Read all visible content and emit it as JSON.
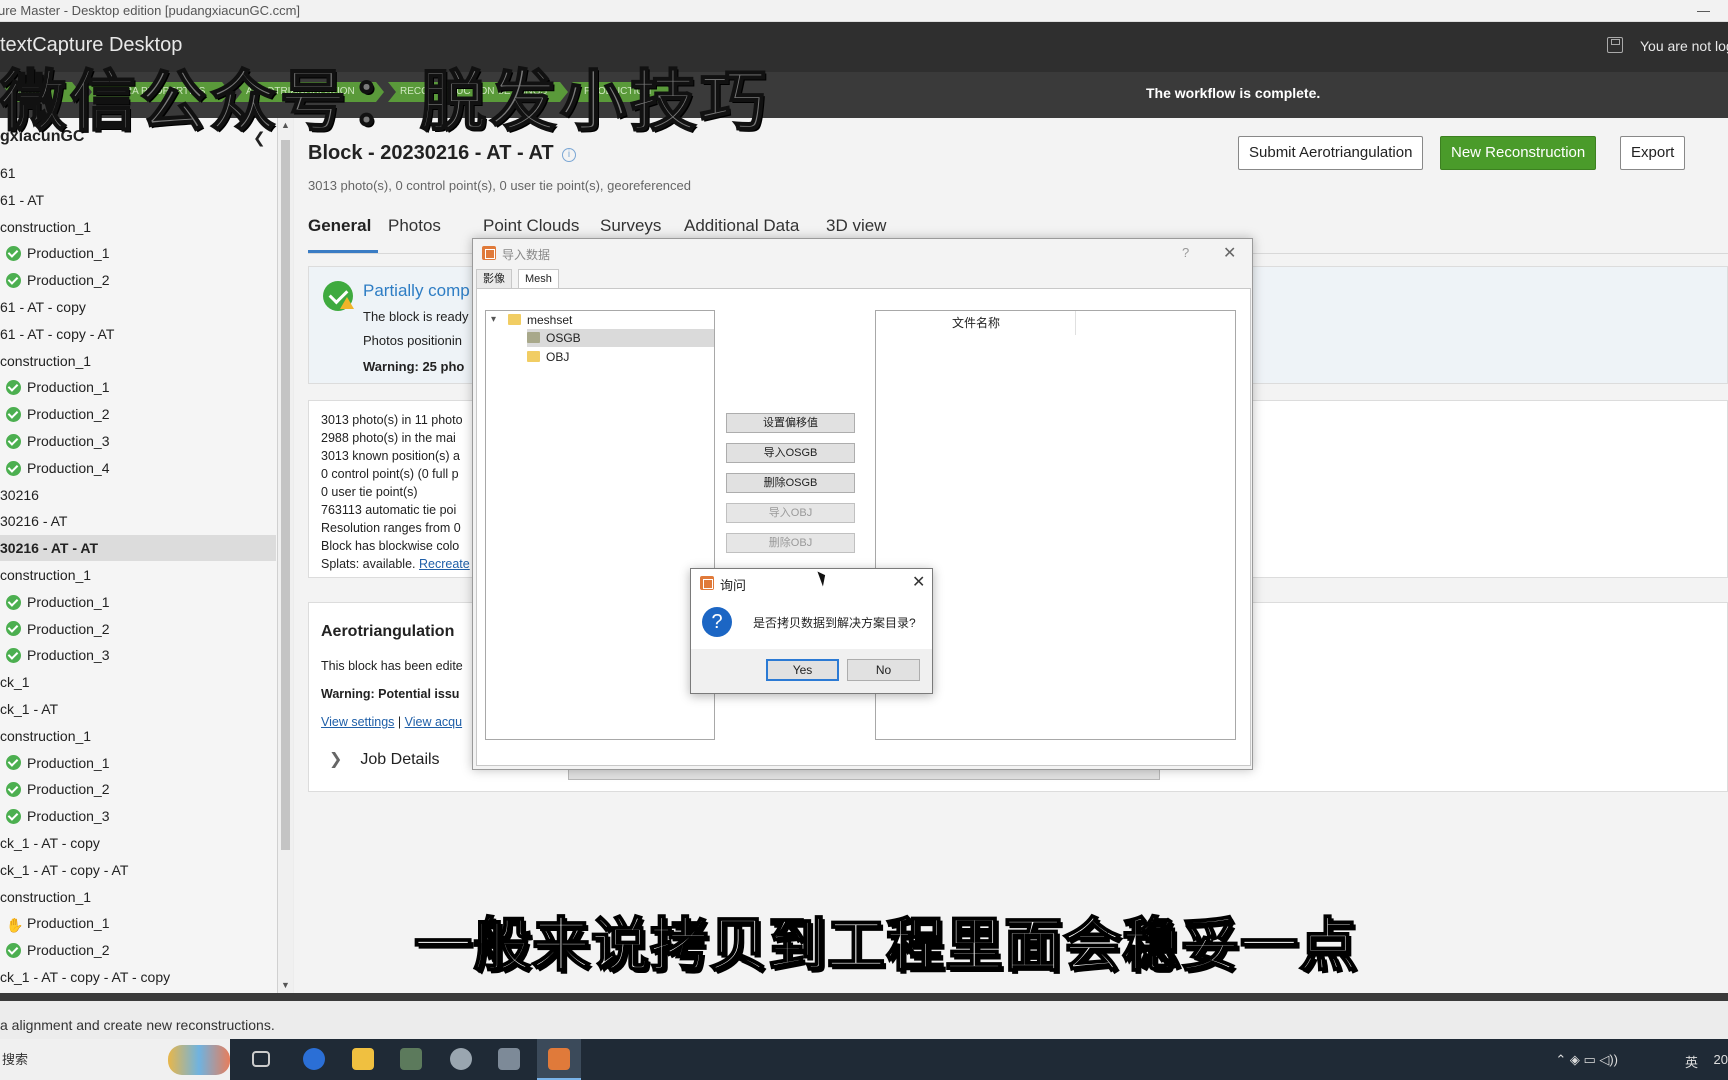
{
  "window": {
    "title": "ure Master - Desktop edition [pudangxiacunGC.ccm]",
    "minimize": "—"
  },
  "appbar": {
    "app_name": "textCapture Desktop",
    "user_status": "You are not log"
  },
  "watermark": "微信公众号：脱发小技巧",
  "workflow": {
    "steps": [
      "OUDS",
      "CAMERA PROPERTIES",
      "AEROTRIANGULATION",
      "RECONSTRUCTION SETTINGS",
      "PRODUCTION"
    ],
    "status": "The workflow is complete."
  },
  "sidebar": {
    "project": "gxiacunGC",
    "items": [
      {
        "label": "61",
        "indent": 0,
        "icon": ""
      },
      {
        "label": "61 - AT",
        "indent": 0,
        "icon": ""
      },
      {
        "label": "construction_1",
        "indent": 0,
        "icon": ""
      },
      {
        "label": "Production_1",
        "indent": 1,
        "icon": "ok"
      },
      {
        "label": "Production_2",
        "indent": 1,
        "icon": "ok"
      },
      {
        "label": "61 - AT - copy",
        "indent": 0,
        "icon": ""
      },
      {
        "label": "61 - AT - copy - AT",
        "indent": 0,
        "icon": ""
      },
      {
        "label": "construction_1",
        "indent": 0,
        "icon": ""
      },
      {
        "label": "Production_1",
        "indent": 1,
        "icon": "ok"
      },
      {
        "label": "Production_2",
        "indent": 1,
        "icon": "ok"
      },
      {
        "label": "Production_3",
        "indent": 1,
        "icon": "ok"
      },
      {
        "label": "Production_4",
        "indent": 1,
        "icon": "ok"
      },
      {
        "label": "30216",
        "indent": 0,
        "icon": ""
      },
      {
        "label": "30216 - AT",
        "indent": 0,
        "icon": ""
      },
      {
        "label": "30216 - AT - AT",
        "indent": 0,
        "icon": "",
        "selected": true
      },
      {
        "label": "construction_1",
        "indent": 0,
        "icon": ""
      },
      {
        "label": "Production_1",
        "indent": 1,
        "icon": "ok"
      },
      {
        "label": "Production_2",
        "indent": 1,
        "icon": "ok"
      },
      {
        "label": "Production_3",
        "indent": 1,
        "icon": "ok"
      },
      {
        "label": "ck_1",
        "indent": 0,
        "icon": ""
      },
      {
        "label": "ck_1 - AT",
        "indent": 0,
        "icon": ""
      },
      {
        "label": "construction_1",
        "indent": 0,
        "icon": ""
      },
      {
        "label": "Production_1",
        "indent": 1,
        "icon": "ok"
      },
      {
        "label": "Production_2",
        "indent": 1,
        "icon": "ok"
      },
      {
        "label": "Production_3",
        "indent": 1,
        "icon": "ok"
      },
      {
        "label": "ck_1 - AT - copy",
        "indent": 0,
        "icon": ""
      },
      {
        "label": "ck_1 - AT - copy - AT",
        "indent": 0,
        "icon": ""
      },
      {
        "label": "construction_1",
        "indent": 0,
        "icon": ""
      },
      {
        "label": "Production_1",
        "indent": 1,
        "icon": "hand"
      },
      {
        "label": "Production_2",
        "indent": 1,
        "icon": "ok"
      },
      {
        "label": "ck_1 - AT - copy - AT - copy",
        "indent": 0,
        "icon": ""
      }
    ]
  },
  "main": {
    "block_title": "Block - 20230216 - AT - AT",
    "info_icon": "ⓘ",
    "subtitle": "3013 photo(s), 0 control point(s), 0 user tie point(s), georeferenced",
    "buttons": {
      "submit_at": "Submit Aerotriangulation",
      "new_reconstruction": "New Reconstruction",
      "export": "Export"
    },
    "tabs": [
      "General",
      "Photos",
      "Point Clouds",
      "Surveys",
      "Additional Data",
      "3D view"
    ],
    "status_card": {
      "title": "Partially comp",
      "line1": "The block is ready",
      "line2": "Photos positionin",
      "warning": "Warning: 25 pho"
    },
    "stats": [
      "3013 photo(s) in 11 photo",
      "2988 photo(s) in the mai",
      "3013 known position(s) a",
      "0 control point(s) (0 full p",
      "0 user tie point(s)",
      "763113 automatic tie poi",
      "Resolution ranges from 0",
      "Block has blockwise colo",
      "Splats: available."
    ],
    "splats_link": "Recreate",
    "at_card": {
      "title": "Aerotriangulation",
      "text1": "This block has been edite",
      "warning": "Warning: Potential issu",
      "link1": "View settings",
      "sep": "|",
      "link2": "View acqu",
      "job_details": "Job Details"
    }
  },
  "import_dialog": {
    "title": "导入数据",
    "help": "?",
    "tabs": [
      "影像",
      "Mesh"
    ],
    "tree": {
      "root": "meshset",
      "children": [
        "OSGB",
        "OBJ"
      ]
    },
    "buttons": [
      "设置偏移值",
      "导入OSGB",
      "删除OSGB",
      "导入OBJ",
      "删除OBJ"
    ],
    "file_header": "文件名称"
  },
  "question": {
    "title": "询问",
    "message": "是否拷贝数据到解决方案目录?",
    "yes": "Yes",
    "no": "No"
  },
  "status_message": "a alignment and create new reconstructions.",
  "caption": "一般来说拷贝到工程里面会稳妥一点",
  "taskbar": {
    "search": "搜索",
    "tray_ime": "英",
    "tray_time": "20"
  },
  "colors": {
    "accent_green": "#4a9b2a",
    "link_blue": "#1f5fa8",
    "dark_bar": "#2f2f2f"
  }
}
